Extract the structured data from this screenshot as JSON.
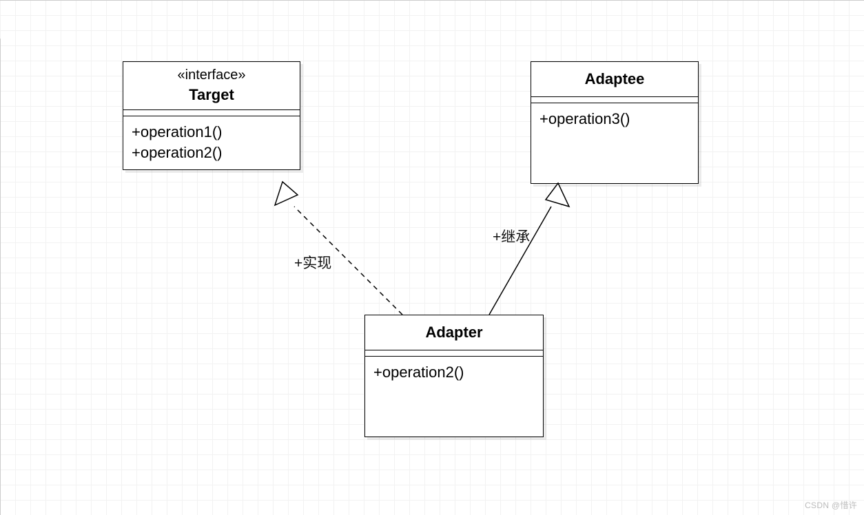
{
  "classes": {
    "target": {
      "stereotype": "«interface»",
      "name": "Target",
      "ops": [
        "+operation1()",
        "+operation2()"
      ]
    },
    "adaptee": {
      "name": "Adaptee",
      "ops": [
        "+operation3()"
      ]
    },
    "adapter": {
      "name": "Adapter",
      "ops": [
        "+operation2()"
      ]
    }
  },
  "edges": {
    "realize_label": "+实现",
    "inherit_label": "+继承"
  },
  "watermark": "CSDN @惜许"
}
